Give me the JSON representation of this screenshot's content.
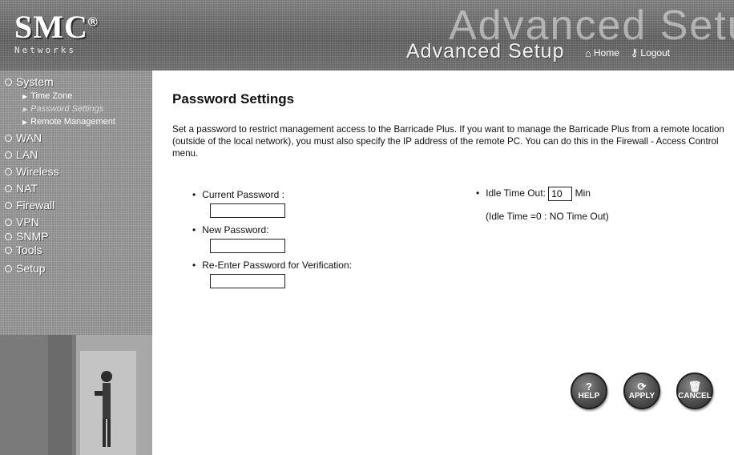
{
  "header": {
    "logo": "SMC",
    "logo_mark": "®",
    "tagline": "Networks",
    "banner_text": "Advanced Setup",
    "title": "Advanced Setup",
    "nav": [
      {
        "label": "Home",
        "icon": "home-icon"
      },
      {
        "label": "Logout",
        "icon": "logout-icon"
      }
    ]
  },
  "sidebar": {
    "system": "System",
    "sub_items": [
      "Time Zone",
      "Password Settings",
      "Remote Management"
    ],
    "items": [
      "WAN",
      "LAN",
      "Wireless",
      "NAT",
      "Firewall",
      "VPN",
      "SNMP",
      "Tools",
      "Setup"
    ]
  },
  "main": {
    "title": "Password Settings",
    "intro": "Set a password to restrict management access to the Barricade Plus. If you want to manage the Barricade Plus from a remote location (outside of the local network), you must also specify the IP address of the remote PC. You can do this in the Firewall - Access Control menu.",
    "current_password_label": "Current Password :",
    "new_password_label": "New Password:",
    "reenter_password_label": "Re-Enter Password for Verification:",
    "idle_label": "Idle Time Out:",
    "idle_value": "10",
    "idle_unit": "Min",
    "idle_note": "(Idle Time =0 : NO Time Out)"
  },
  "buttons": {
    "help": "HELP",
    "apply": "APPLY",
    "cancel": "CANCEL"
  },
  "colors": {
    "header_bg": "#666666",
    "sidebar_bg": "#8c8c8c",
    "button_bg": "#4d4d4d"
  }
}
